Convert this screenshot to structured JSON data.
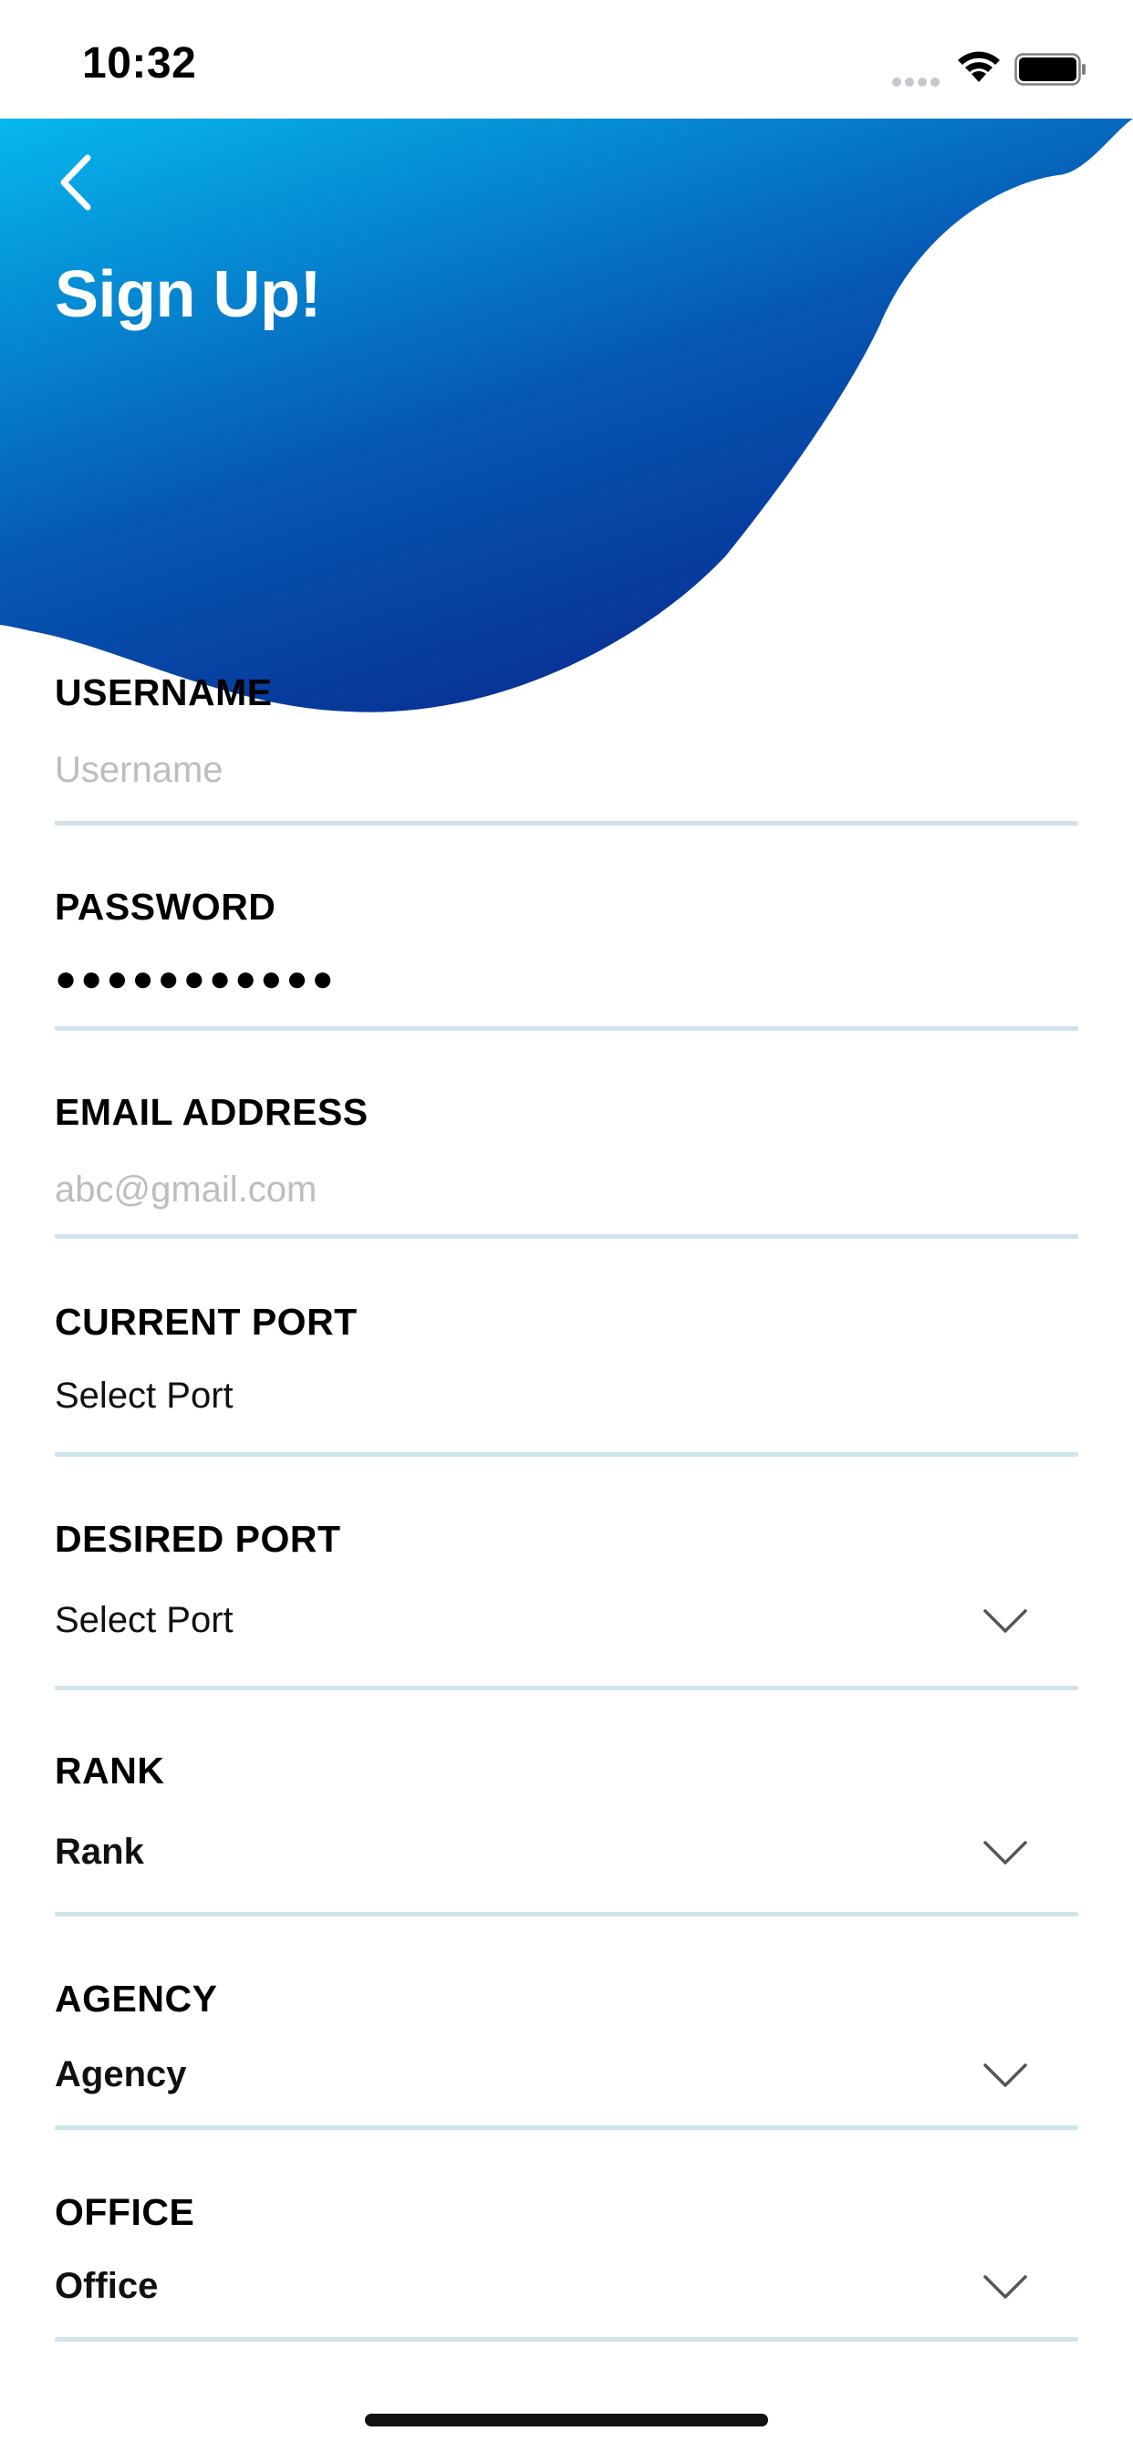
{
  "status_bar": {
    "time": "10:32"
  },
  "header": {
    "title": "Sign Up!",
    "back_icon": "chevron-left-icon"
  },
  "colors": {
    "gradient_start": "#06b7ef",
    "gradient_end": "#082a8e",
    "divider": "#cfe3ea"
  },
  "form": {
    "username": {
      "label": "USERNAME",
      "placeholder": "Username"
    },
    "password": {
      "label": "PASSWORD",
      "value": "●●●●●●●●●●●"
    },
    "email": {
      "label": "EMAIL ADDRESS",
      "placeholder": "abc@gmail.com"
    },
    "current_port": {
      "label": "CURRENT PORT",
      "value": "Select Port"
    },
    "desired_port": {
      "label": "DESIRED PORT",
      "value": "Select Port",
      "icon": "chevron-down-icon"
    },
    "rank": {
      "label": "RANK",
      "value": "Rank",
      "icon": "chevron-down-icon"
    },
    "agency": {
      "label": "AGENCY",
      "value": "Agency",
      "icon": "chevron-down-icon"
    },
    "office": {
      "label": "OFFICE",
      "value": "Office",
      "icon": "chevron-down-icon"
    }
  }
}
